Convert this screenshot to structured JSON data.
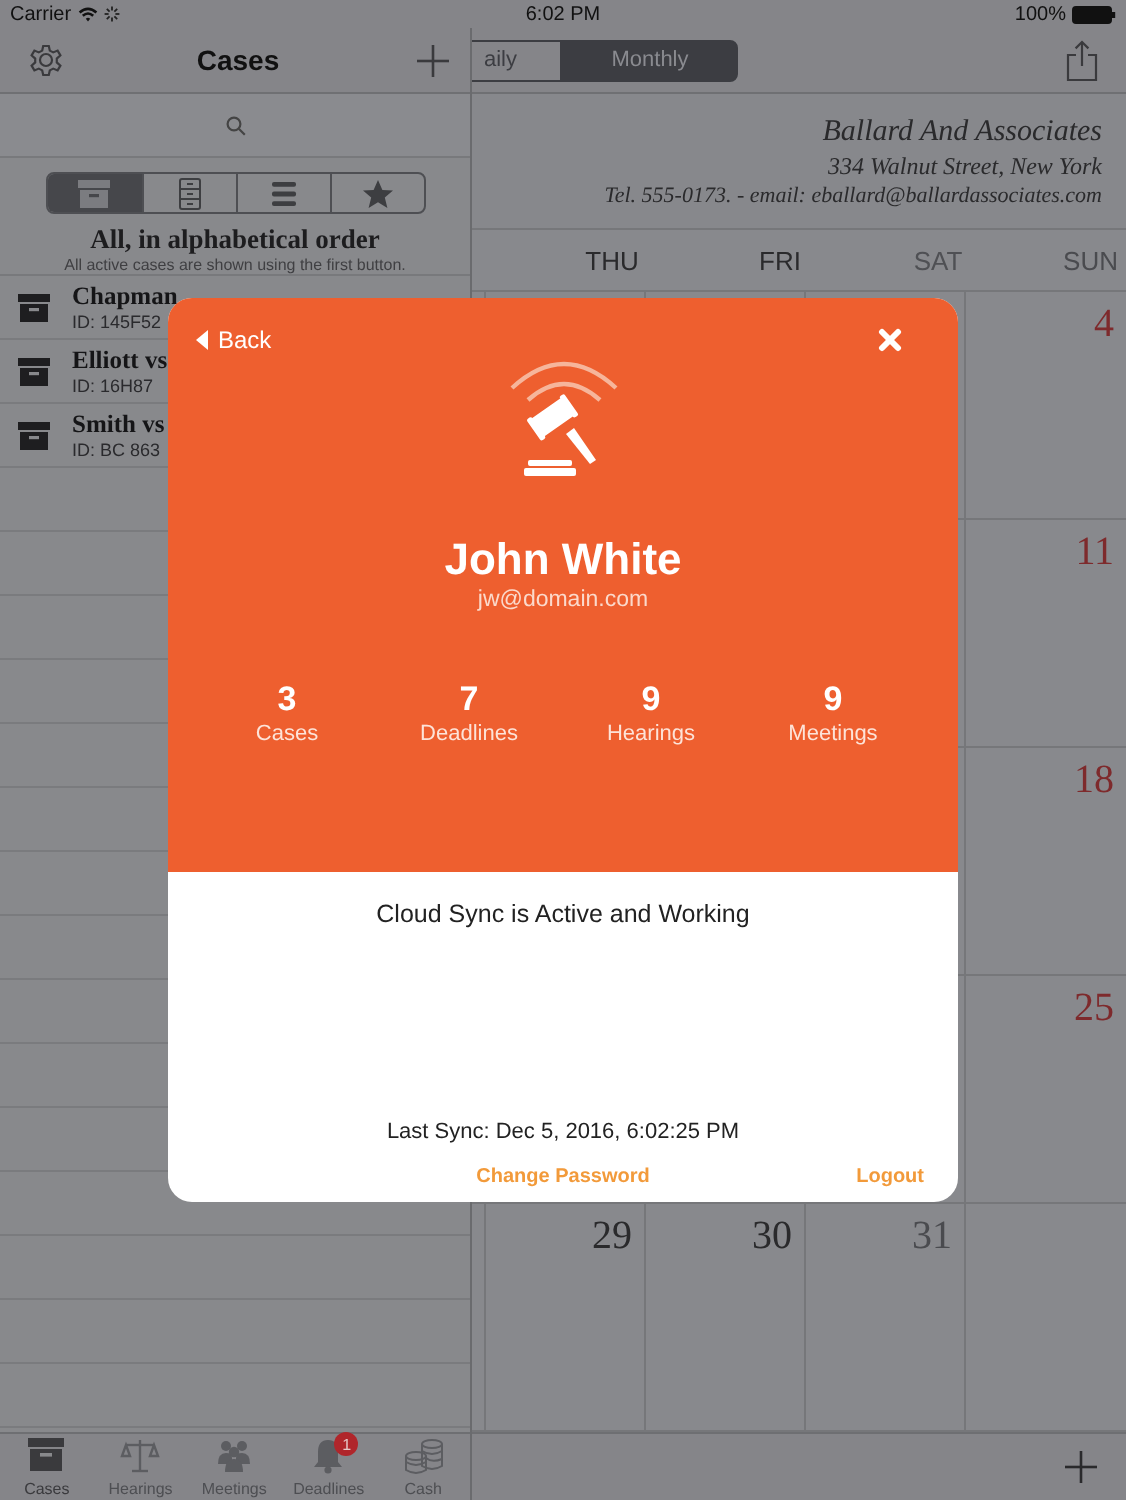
{
  "status_bar": {
    "carrier": "Carrier",
    "time": "6:02 PM",
    "battery": "100%"
  },
  "sidebar": {
    "title": "Cases",
    "filter_buttons": [
      {
        "kind": "archive",
        "selected": true
      },
      {
        "kind": "cabinet",
        "selected": false
      },
      {
        "kind": "list",
        "selected": false
      },
      {
        "kind": "star",
        "selected": false
      }
    ],
    "filter_title": "All, in alphabetical order",
    "filter_hint": "All active cases are shown using the first button.",
    "cases": [
      {
        "name": "Chapman",
        "id": "ID: 145F52"
      },
      {
        "name": "Elliott vs",
        "id": "ID: 16H87"
      },
      {
        "name": "Smith vs",
        "id": "ID: BC 863"
      }
    ]
  },
  "tab_bar": {
    "tabs": [
      {
        "label": "Cases",
        "kind": "archive",
        "selected": true
      },
      {
        "label": "Hearings",
        "kind": "scales",
        "selected": false
      },
      {
        "label": "Meetings",
        "kind": "people",
        "selected": false
      },
      {
        "label": "Deadlines",
        "kind": "bell",
        "selected": false,
        "badge": "1"
      },
      {
        "label": "Cash",
        "kind": "coins",
        "selected": false
      }
    ]
  },
  "calendar": {
    "view_tabs": [
      {
        "label": "aily",
        "selected": false
      },
      {
        "label": "Monthly",
        "selected": true
      }
    ],
    "letterhead": {
      "name": "Ballard And Associates",
      "address": "334 Walnut Street, New York",
      "contact": "Tel. 555-0173. -  email: eballard@ballardassociates.com"
    },
    "weekdays": [
      {
        "label": "THU",
        "kind": "weekday"
      },
      {
        "label": "FRI",
        "kind": "weekday"
      },
      {
        "label": "SAT",
        "kind": "saturday"
      },
      {
        "label": "SUN",
        "kind": "sunday"
      }
    ],
    "weeks": [
      {
        "sun": {
          "day": "4",
          "kind": "sunday"
        }
      },
      {
        "sun": {
          "day": "11",
          "kind": "sunday"
        }
      },
      {
        "sun": {
          "day": "18",
          "kind": "sunday"
        }
      },
      {
        "sun": {
          "day": "25",
          "kind": "sunday"
        }
      },
      {
        "thu": {
          "day": "29",
          "kind": "weekday"
        },
        "fri": {
          "day": "30",
          "kind": "weekday"
        },
        "sat": {
          "day": "31",
          "kind": "saturday"
        }
      }
    ]
  },
  "profile": {
    "back": "Back",
    "name": "John White",
    "email": "jw@domain.com",
    "stats": [
      {
        "value": "3",
        "label": "Cases"
      },
      {
        "value": "7",
        "label": "Deadlines"
      },
      {
        "value": "9",
        "label": "Hearings"
      },
      {
        "value": "9",
        "label": "Meetings"
      }
    ],
    "status": "Cloud Sync is Active and Working",
    "last_sync": "Last Sync: Dec 5, 2016, 6:02:25 PM",
    "links": [
      "Change Password",
      "Logout"
    ]
  }
}
